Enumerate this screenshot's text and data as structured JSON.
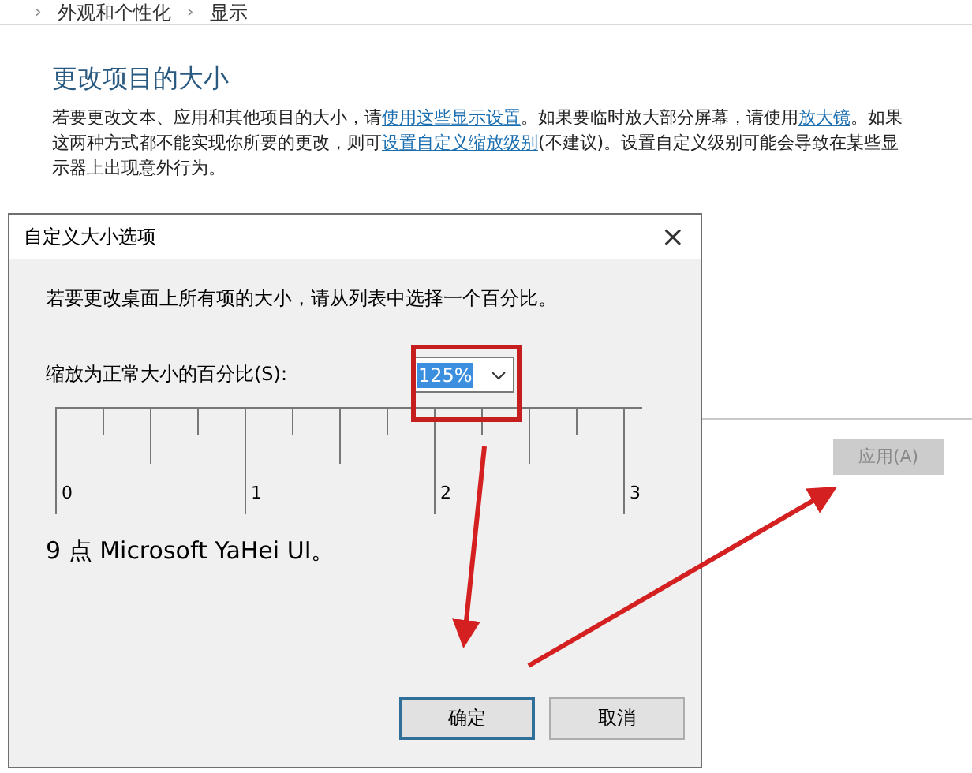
{
  "breadcrumb": [
    {
      "separator": "›",
      "label": "外观和个性化"
    },
    {
      "separator": "›",
      "label": "显示"
    }
  ],
  "section": {
    "heading": "更改项目的大小",
    "paragraph": [
      {
        "text": "若要更改文本、应用和其他项目的大小，请",
        "link": false
      },
      {
        "text": "使用这些显示设置",
        "link": true
      },
      {
        "text": "。如果要临时放大部分屏幕，请使用",
        "link": false
      },
      {
        "text": "放大镜",
        "link": true
      },
      {
        "text": "。如果这两种方式都不能实现你所要的更改，则可",
        "link": false
      },
      {
        "text": "设置自定义缩放级别",
        "link": true
      },
      {
        "text": "(不建议)。设置自定义级别可能会导致在某些显示器上出现意外行为。",
        "link": false
      }
    ]
  },
  "apply_button": {
    "label": "应用(A)",
    "disabled": true
  },
  "dialog": {
    "title": "自定义大小选项",
    "close": "×",
    "instruction": "若要更改桌面上所有项的大小，请从列表中选择一个百分比。",
    "scale_label": "缩放为正常大小的百分比(S):",
    "scale_value": "125%",
    "ruler_labels": [
      "0",
      "1",
      "2",
      "3"
    ],
    "font_sample": "9 点 Microsoft YaHei UI。",
    "buttons": [
      {
        "label": "确定",
        "default": true
      },
      {
        "label": "取消",
        "default": false
      }
    ]
  }
}
